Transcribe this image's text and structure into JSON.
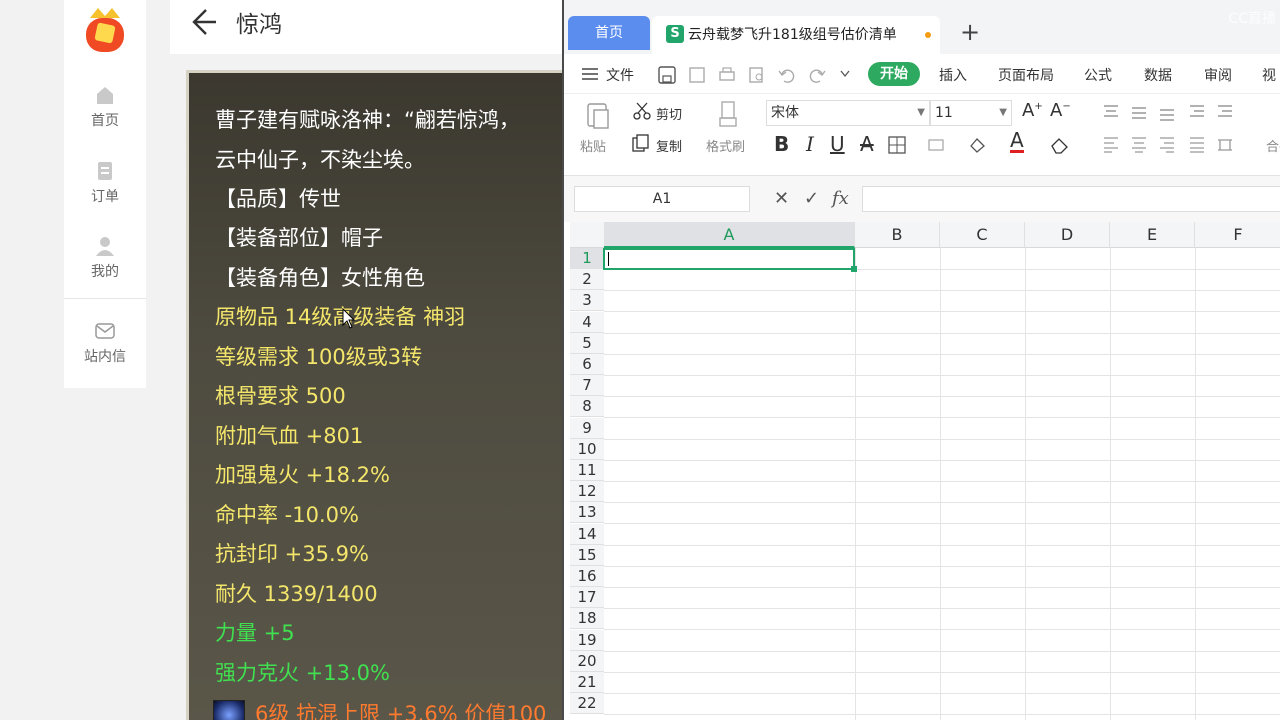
{
  "left_app": {
    "nav": [
      {
        "label": "首页",
        "icon": "home-icon"
      },
      {
        "label": "订单",
        "icon": "order-icon"
      },
      {
        "label": "我的",
        "icon": "user-icon"
      },
      {
        "label": "站内信",
        "icon": "mail-icon"
      }
    ],
    "page_title": "惊鸿"
  },
  "item_tooltip": {
    "lines": [
      "曹子建有赋咏洛神：“翩若惊鸿，",
      "云中仙子，不染尘埃。",
      "【品质】传世",
      "【装备部位】帽子",
      "【装备角色】女性角色",
      "原物品 14级高级装备 神羽",
      "等级需求 100级或3转",
      "根骨要求 500",
      "附加气血 +801",
      "加强鬼火 +18.2%",
      "命中率 -10.0%",
      "抗封印 +35.9%",
      "耐久 1339/1400",
      "力量 +5",
      "强力克火 +13.0%",
      "6级 抗混上限 +3.6% 价值100"
    ],
    "colors": {
      "white": "#ffffff",
      "yellow": "#f4e66b",
      "green": "#40e050",
      "orange": "#ff7a2e"
    }
  },
  "wps": {
    "tabs": {
      "home": "首页",
      "doc": "云舟载梦飞升181级组号估价清单"
    },
    "new_tab": "+",
    "watermark": "CC直播",
    "menu": {
      "file": "文件",
      "start": "开始",
      "insert": "插入",
      "layout": "页面布局",
      "formula": "公式",
      "data": "数据",
      "review": "审阅",
      "view": "视"
    },
    "ribbon": {
      "paste": "粘贴",
      "cut": "剪切",
      "copy": "复制",
      "format_painter": "格式刷",
      "font": "宋体",
      "font_size": "11",
      "merge": "合并"
    },
    "name_box": "A1",
    "fx": "fx",
    "columns": [
      "A",
      "B",
      "C",
      "D",
      "E",
      "F"
    ],
    "rows": [
      "1",
      "2",
      "3",
      "4",
      "5",
      "6",
      "7",
      "8",
      "9",
      "10",
      "11",
      "12",
      "13",
      "14",
      "15",
      "16",
      "17",
      "18",
      "19",
      "20",
      "21",
      "22"
    ],
    "accent": "#22a56b"
  }
}
